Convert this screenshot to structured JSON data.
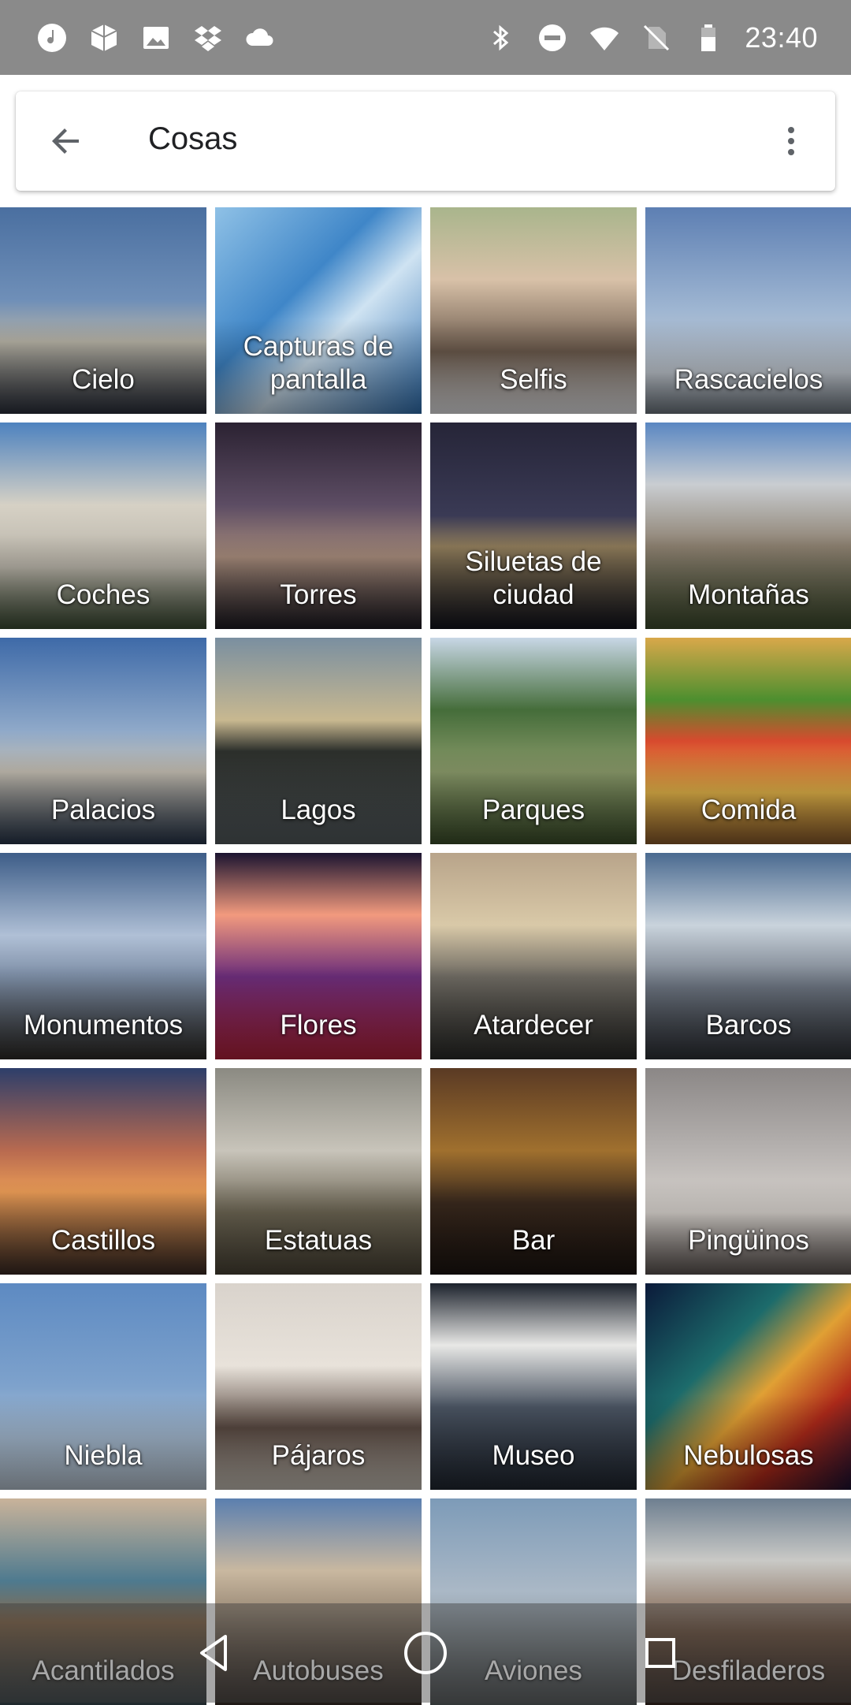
{
  "status_bar": {
    "time": "23:40",
    "left_icons": [
      "music-icon",
      "cube-icon",
      "image-icon",
      "dropbox-icon",
      "cloud-icon"
    ],
    "right_icons": [
      "bluetooth-icon",
      "do-not-disturb-icon",
      "wifi-icon",
      "no-sim-icon",
      "battery-icon"
    ]
  },
  "header": {
    "title": "Cosas",
    "back_icon": "arrow-back-icon",
    "menu_icon": "more-vert-icon"
  },
  "categories": [
    {
      "label": "Cielo",
      "bg": "linear-gradient(180deg,#4a6fa0 0%,#6f8fb8 45%,#b7b3a6 65%,#2a2f3b 100%)"
    },
    {
      "label": "Capturas de pantalla",
      "bg": "linear-gradient(135deg,#8fc1e6 0%,#3f86c8 40%,#cfe3f2 60%,#2f6fb0 100%)"
    },
    {
      "label": "Selfis",
      "bg": "linear-gradient(180deg,#a9b58c 0%,#d8c1a8 35%,#6b5a4c 70%,#e8e8ea 100%)"
    },
    {
      "label": "Rascacielos",
      "bg": "linear-gradient(180deg,#5d7fb3 0%,#9fb6d2 50%,#c7ced6 80%,#6d767f 100%)"
    },
    {
      "label": "Coches",
      "bg": "linear-gradient(180deg,#4d82bf 0%,#d6d1c5 40%,#b8b3a8 70%,#3b4b33 100%)"
    },
    {
      "label": "Torres",
      "bg": "linear-gradient(180deg,#2b2232 0%,#5d4d64 40%,#a58a7a 65%,#1d1a22 100%)"
    },
    {
      "label": "Siluetas de ciudad",
      "bg": "linear-gradient(180deg,#262538 0%,#3a3a55 45%,#8e7b5a 60%,#11131c 100%)"
    },
    {
      "label": "Montañas",
      "bg": "linear-gradient(180deg,#5a87c2 0%,#c9cdd1 30%,#8c8070 60%,#3c4a2c 100%)"
    },
    {
      "label": "Palacios",
      "bg": "linear-gradient(180deg,#3e6aa8 0%,#8fa9c9 45%,#c2bcb0 65%,#28364a 100%)"
    },
    {
      "label": "Lagos",
      "bg": "linear-gradient(180deg,#7a8fa0 0%,#c8b890 40%,#2c2f2b 55%,#545b5e 100%)"
    },
    {
      "label": "Parques",
      "bg": "linear-gradient(180deg,#c8d7e6 0%,#456d3a 35%,#8a9a6a 65%,#3b4e2a 100%)"
    },
    {
      "label": "Comida",
      "bg": "linear-gradient(180deg,#d9a84a 0%,#4d8f2f 30%,#d84a2e 50%,#e7b74a 75%,#8a5a2a 100%)"
    },
    {
      "label": "Monumentos",
      "bg": "linear-gradient(180deg,#3d5d88 0%,#b0c0d6 40%,#7d8ea6 60%,#2d2a26 100%)"
    },
    {
      "label": "Flores",
      "bg": "linear-gradient(180deg,#1b1430 0%,#f29a7e 30%,#6b2d7a 60%,#b4223a 100%)"
    },
    {
      "label": "Atardecer",
      "bg": "linear-gradient(180deg,#b8a48a 0%,#d9c9a8 35%,#6e6a62 60%,#2a2a28 100%)"
    },
    {
      "label": "Barcos",
      "bg": "linear-gradient(180deg,#4a6a90 0%,#c9d3dc 35%,#6c7480 65%,#2e3136 100%)"
    },
    {
      "label": "Castillos",
      "bg": "linear-gradient(180deg,#2d3e6a 0%,#b86a50 40%,#e89a55 60%,#3a2a24 100%)"
    },
    {
      "label": "Estatuas",
      "bg": "linear-gradient(180deg,#8b8a82 0%,#c8c4ba 40%,#6d6654 70%,#4a4436 100%)"
    },
    {
      "label": "Bar",
      "bg": "linear-gradient(180deg,#5a3a24 0%,#a0702e 40%,#3b2a1e 65%,#1c1410 100%)"
    },
    {
      "label": "Pingüinos",
      "bg": "linear-gradient(180deg,#8b8786 0%,#b6b2b0 40%,#d9d4cf 70%,#5d5552 100%)"
    },
    {
      "label": "Niebla",
      "bg": "linear-gradient(180deg,#5d8ac2 0%,#7ea2cc 50%,#a9bfd6 75%,#b9c6d2 100%)"
    },
    {
      "label": "Pájaros",
      "bg": "linear-gradient(180deg,#d9d3cc 0%,#e8e2da 40%,#5a4a42 70%,#c9c2b8 100%)"
    },
    {
      "label": "Museo",
      "bg": "linear-gradient(180deg,#1c222c 0%,#e8e8e6 30%,#4a5462 60%,#202630 100%)"
    },
    {
      "label": "Nebulosas",
      "bg": "linear-gradient(135deg,#0b1a3a 0%,#1c6b6b 35%,#e0a034 55%,#b02a1a 75%,#1a1030 100%)"
    },
    {
      "label": "Acantilados",
      "bg": "linear-gradient(180deg,#c9b39a 0%,#4e7a8f 40%,#8a6a4a 60%,#3a4a52 100%)"
    },
    {
      "label": "Autobuses",
      "bg": "linear-gradient(180deg,#5b7faf 0%,#c9b8a0 35%,#7a6a5a 70%,#3a2f2a 100%)"
    },
    {
      "label": "Aviones",
      "bg": "linear-gradient(180deg,#7d9bb8 0%,#aab8c6 45%,#8c969c 70%,#5d6366 100%)"
    },
    {
      "label": "Desfiladeros",
      "bg": "linear-gradient(180deg,#6e7f90 0%,#c9c9c6 30%,#7a5a44 65%,#3a2a22 100%)"
    }
  ],
  "nav_bar": {
    "back_icon": "nav-back-triangle-icon",
    "home_icon": "nav-home-circle-icon",
    "recents_icon": "nav-recents-square-icon"
  }
}
